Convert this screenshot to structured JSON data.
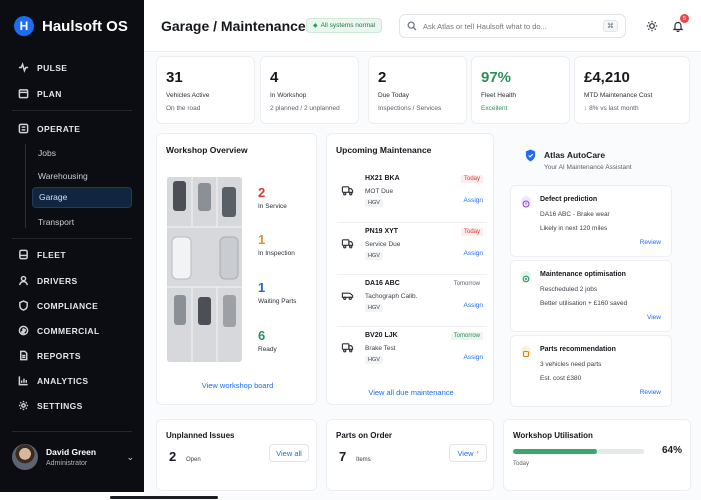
{
  "app": {
    "name": "Haulsoft OS",
    "logo_letter": "H"
  },
  "sidebar": {
    "nav_top": [
      {
        "label": "PULSE",
        "icon": "pulse-icon"
      },
      {
        "label": "PLAN",
        "icon": "calendar-icon"
      }
    ],
    "operate": {
      "label": "OPERATE",
      "icon": "operate-icon",
      "children": [
        "Jobs",
        "Warehousing",
        "Garage",
        "Transport"
      ],
      "active": "Garage"
    },
    "nav_bottom": [
      {
        "label": "FLEET",
        "icon": "fleet-icon"
      },
      {
        "label": "DRIVERS",
        "icon": "drivers-icon"
      },
      {
        "label": "COMPLIANCE",
        "icon": "compliance-icon"
      },
      {
        "label": "COMMERCIAL",
        "icon": "commercial-icon"
      },
      {
        "label": "REPORTS",
        "icon": "reports-icon"
      },
      {
        "label": "ANALYTICS",
        "icon": "analytics-icon"
      },
      {
        "label": "SETTINGS",
        "icon": "gear-icon"
      }
    ],
    "user": {
      "name": "David Green",
      "role": "Administrator"
    }
  },
  "header": {
    "title": "Garage / Maintenance",
    "status": "All systems normal",
    "search_placeholder": "Ask Atlas or tell Haulsoft what to do...",
    "search_shortcut": "⌘",
    "notifications_count": "5"
  },
  "kpis": [
    {
      "value": "31",
      "label": "Vehicles Active",
      "sub": "On the road"
    },
    {
      "value": "4",
      "label": "In Workshop",
      "sub": "2 planned / 2 unplanned"
    },
    {
      "value": "2",
      "label": "Due Today",
      "sub": "Inspections / Services"
    },
    {
      "value": "97%",
      "label": "Fleet Health",
      "sub": "Excellent"
    },
    {
      "value": "£4,210",
      "label": "MTD Maintenance Cost",
      "sub": "8% vs last month"
    }
  ],
  "workshop": {
    "title": "Workshop Overview",
    "stats": [
      {
        "value": "2",
        "label": "In Service",
        "color": "#d93b3b"
      },
      {
        "value": "1",
        "label": "In Inspection",
        "color": "#e0922a"
      },
      {
        "value": "1",
        "label": "Waiting Parts",
        "color": "#2563eb"
      },
      {
        "value": "6",
        "label": "Ready",
        "color": "#2f8f5b"
      }
    ],
    "link": "View workshop board"
  },
  "maintenance": {
    "title": "Upcoming Maintenance",
    "items": [
      {
        "reg": "HX21 BKA",
        "type": "MOT Due",
        "tag": "HGV",
        "when": "Today",
        "action": "Assign"
      },
      {
        "reg": "PN19 XYT",
        "type": "Service Due",
        "tag": "HGV",
        "when": "Today",
        "action": "Assign"
      },
      {
        "reg": "DA16 ABC",
        "type": "Tachograph Calib.",
        "tag": "HGV",
        "when": "Tomorrow",
        "action": "Assign"
      },
      {
        "reg": "BV20 LJK",
        "type": "Brake Test",
        "tag": "HGV",
        "when": "Tomorrow",
        "action": "Assign"
      }
    ],
    "link": "View all due maintenance"
  },
  "atlas": {
    "title": "Atlas AutoCare",
    "subtitle": "Your AI Maintenance Assistant",
    "cards": [
      {
        "title": "Defect prediction",
        "l1": "DA16 ABC - Brake wear",
        "l2": "Likely in next 120 miles",
        "action": "Review"
      },
      {
        "title": "Maintenance optimisation",
        "l1": "Rescheduled 2 jobs",
        "l2": "Better utilisation + £160 saved",
        "action": "View"
      },
      {
        "title": "Parts recommendation",
        "l1": "3 vehicles need parts",
        "l2": "Est. cost £380",
        "action": "Review"
      }
    ]
  },
  "bottom": {
    "unplanned": {
      "title": "Unplanned Issues",
      "value": "2",
      "unit": "Open",
      "link": "View all"
    },
    "parts": {
      "title": "Parts on Order",
      "value": "7",
      "unit": "Items",
      "link": "View"
    },
    "utilisation": {
      "title": "Workshop Utilisation",
      "value": "64%",
      "fraction": 0.64,
      "sub": "Today"
    }
  }
}
